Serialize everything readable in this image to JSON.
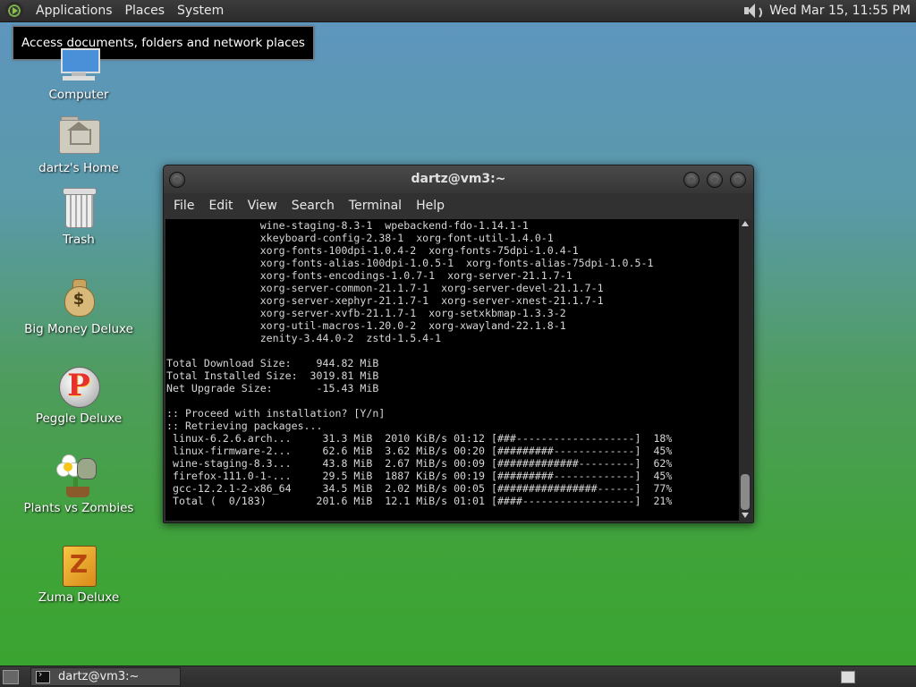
{
  "top_panel": {
    "menus": [
      "Applications",
      "Places",
      "System"
    ],
    "clock": "Wed Mar 15, 11:55 PM"
  },
  "tooltip": "Access documents, folders and network places",
  "desktop_icons": {
    "computer": "Computer",
    "home": "dartz's Home",
    "trash": "Trash",
    "money": "Big Money Deluxe",
    "peggle": "Peggle Deluxe",
    "plants": "Plants vs Zombies",
    "zuma": "Zuma Deluxe"
  },
  "terminal": {
    "title": "dartz@vm3:~",
    "menu": [
      "File",
      "Edit",
      "View",
      "Search",
      "Terminal",
      "Help"
    ],
    "lines": [
      "               wine-staging-8.3-1  wpebackend-fdo-1.14.1-1",
      "               xkeyboard-config-2.38-1  xorg-font-util-1.4.0-1",
      "               xorg-fonts-100dpi-1.0.4-2  xorg-fonts-75dpi-1.0.4-1",
      "               xorg-fonts-alias-100dpi-1.0.5-1  xorg-fonts-alias-75dpi-1.0.5-1",
      "               xorg-fonts-encodings-1.0.7-1  xorg-server-21.1.7-1",
      "               xorg-server-common-21.1.7-1  xorg-server-devel-21.1.7-1",
      "               xorg-server-xephyr-21.1.7-1  xorg-server-xnest-21.1.7-1",
      "               xorg-server-xvfb-21.1.7-1  xorg-setxkbmap-1.3.3-2",
      "               xorg-util-macros-1.20.0-2  xorg-xwayland-22.1.8-1",
      "               zenity-3.44.0-2  zstd-1.5.4-1",
      "",
      "Total Download Size:    944.82 MiB",
      "Total Installed Size:  3019.81 MiB",
      "Net Upgrade Size:       -15.43 MiB",
      "",
      ":: Proceed with installation? [Y/n]",
      ":: Retrieving packages...",
      " linux-6.2.6.arch...     31.3 MiB  2010 KiB/s 01:12 [###-------------------]  18%",
      " linux-firmware-2...     62.6 MiB  3.62 MiB/s 00:20 [#########-------------]  45%",
      " wine-staging-8.3...     43.8 MiB  2.67 MiB/s 00:09 [#############---------]  62%",
      " firefox-111.0-1-...     29.5 MiB  1887 KiB/s 00:19 [#########-------------]  45%",
      " gcc-12.2.1-2-x86_64     34.5 MiB  2.02 MiB/s 00:05 [################------]  77%",
      " Total (  0/183)        201.6 MiB  12.1 MiB/s 01:01 [####------------------]  21%"
    ]
  },
  "bottom_panel": {
    "task": "dartz@vm3:~"
  }
}
